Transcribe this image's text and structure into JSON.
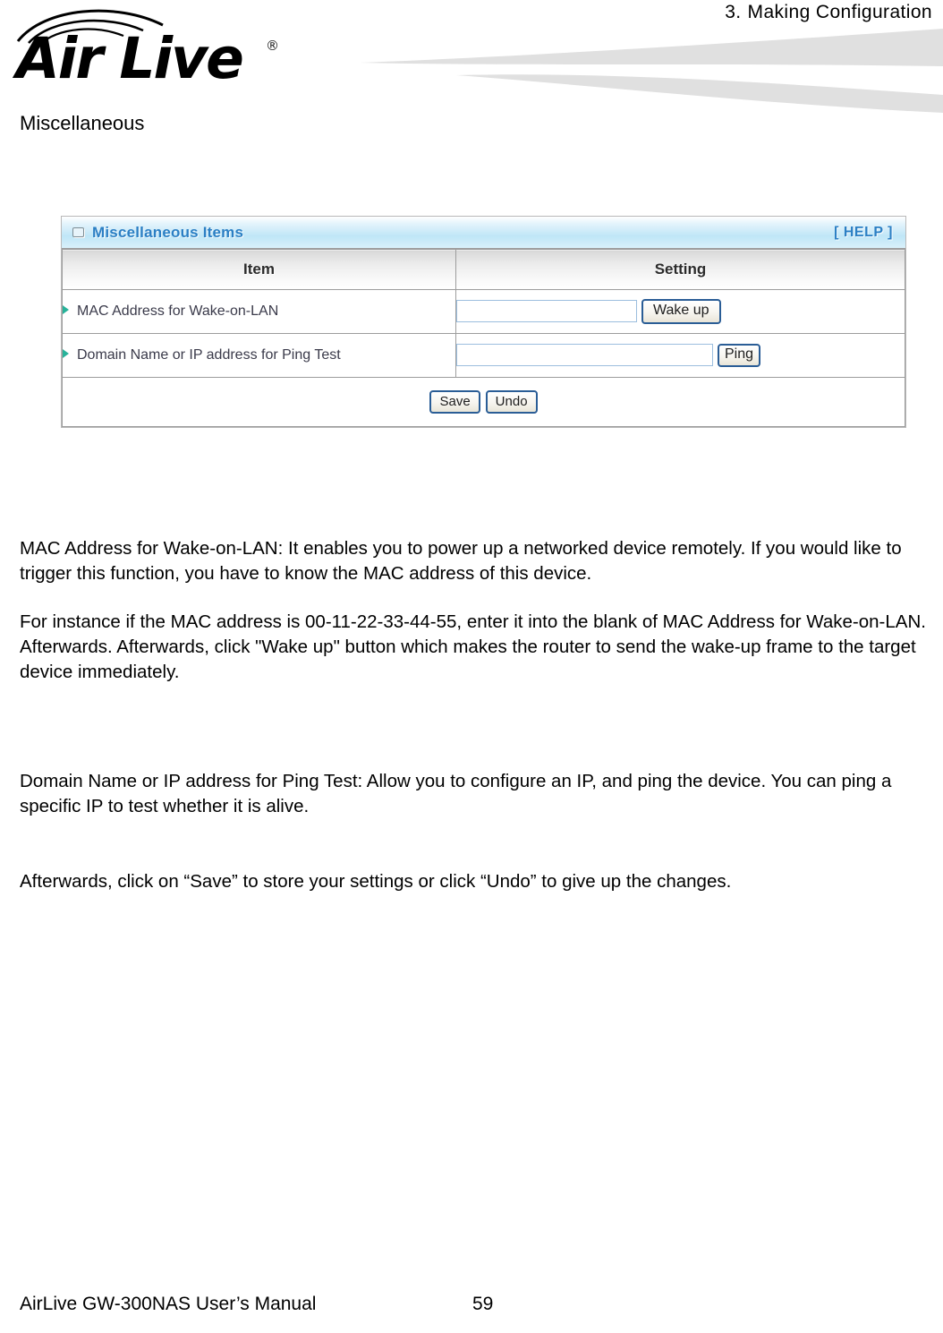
{
  "header": {
    "chapter_number": "3.",
    "chapter_title": "Making  Configuration",
    "logo_text": "Air Live",
    "logo_trademark": "®"
  },
  "section": {
    "heading": "Miscellaneous"
  },
  "panel": {
    "title": "Miscellaneous Items",
    "help_label": "[ HELP ]",
    "columns": {
      "item": "Item",
      "setting": "Setting"
    },
    "rows": [
      {
        "label": "MAC Address for Wake-on-LAN",
        "input_value": "",
        "input_placeholder": "",
        "button_label": "Wake up"
      },
      {
        "label": "Domain Name or IP address for Ping Test",
        "input_value": "",
        "input_placeholder": "",
        "button_label": "Ping"
      }
    ],
    "actions": {
      "save_label": "Save",
      "undo_label": "Undo"
    },
    "colors": {
      "title_text": "#2b7fc4",
      "titlebar_gradient_top": "#e4f4fc",
      "titlebar_gradient_bottom": "#bfe6f7",
      "bullet": "#27b39a",
      "input_border": "#9cbede",
      "button_border": "#2a5d96",
      "table_border": "#9d9d9d",
      "swoosh": "#e0e0e0"
    }
  },
  "body": {
    "paragraph_mac": "MAC Address for Wake-on-LAN:   It enables you to power up a networked device remotely. If you would like to trigger this function, you have to know the MAC address of this device.",
    "paragraph_instance": "For instance if the MAC address is 00-11-22-33-44-55, enter it into the blank of MAC Address for Wake-on-LAN. Afterwards. Afterwards, click \"Wake up\" button which makes the router to send the wake-up frame to the target device immediately.",
    "paragraph_ping": "Domain Name or IP address for Ping Test: Allow you to configure an IP, and ping the device. You can ping a specific IP to test whether it is alive.",
    "paragraph_afterwards": "Afterwards, click on “Save” to store your settings or click “Undo” to give up the changes."
  },
  "footer": {
    "manual_title": "AirLive GW-300NAS User’s Manual",
    "page_number": "59"
  }
}
